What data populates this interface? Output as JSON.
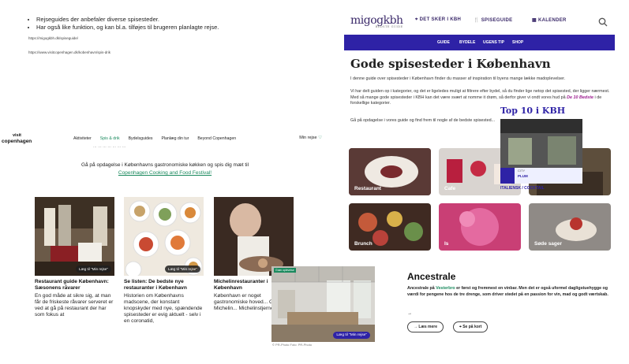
{
  "notes": {
    "bullets": [
      "Rejseguides der anbefaler diverse spisesteder.",
      "Har også like funktion, og kan bl.a. tilføjes til brugeren planlagte rejse."
    ],
    "urls": [
      "https://migogkbh.dk/spiseguide/",
      "https://www.visitcopenhagen.dk/kobenhavn/spis-drik"
    ]
  },
  "visitcph": {
    "logo_small": "visit",
    "logo_big": "copenhagen",
    "menu": [
      "Aktiviteter",
      "Spis & drik",
      "Bydelsguides",
      "Planlæg din tur",
      "Beyond Copenhagen"
    ],
    "my_trip": "Min rejse",
    "cut_text": "... ... ... ... ... ... ...",
    "intro": "Gå på opdagelse i Københavns gastronomiske køkken og spis dig mæt til",
    "intro_link": "Copenhagen Cooking and Food Festival!",
    "save_label": "Læg til \"Min rejse\"",
    "cards": [
      {
        "title": "Restaurant guide København: Sæsonens råvarer",
        "text": "En god måde at sikre sig, at man får de friskeste råvarer serveret er ved at gå på restaurant der har som fokus at"
      },
      {
        "title": "Se listen: De bedste nye restauranter i København",
        "text": "Historien om Københavns madscene, der konstant knopskyder med nye, spændende spisesteder er evig aktuelt - selv i en coronatid,"
      },
      {
        "title": "Michelinrestauranter i København",
        "text": "København er noget gastronomiske hoved... Guide Michelin... Michelinstjerner..."
      }
    ]
  },
  "migogkbh": {
    "logo": "migogkbh",
    "logo_sub": "BEDSTE GUIDE",
    "top_nav": [
      "DET SKER I KBH",
      "SPISEGUIDE",
      "KALENDER"
    ],
    "sub_nav": [
      "GUIDE",
      "BYDELE",
      "UGENS TIP",
      "SHOP"
    ],
    "title": "Gode spisesteder i København",
    "p1": "I denne guide over spisesteder i København finder du masser af inspiration til byens mange lække madoplevelser.",
    "p2": "Vi har delt guiden op i kategorier, og det er ligeledes muligt at filtrere efter bydel, så du finder lige netop det spisested, der ligger nærmest. Med så mange gode spisesteder i KBH kan det være svært at nomme it drøm, så derfor giver vi ondt vores hud på",
    "p2_link": "De 10 Bedste",
    "p2_end": " i de forskellige kategorier.",
    "p3": "Gå på opdagelse i vores guide og find frem til nogle af de bedste spisested...",
    "tiles": [
      "Restaurant",
      "Cafe",
      "",
      "Brunch",
      "Is",
      "Søde sager"
    ],
    "top10_title": "Top 10 i KBH",
    "top10_tag": "CITY",
    "top10_name": "PLUM",
    "top10_label": "ITALIENSK / COCKTAIL"
  },
  "ancestrale": {
    "badge": "Grøn oplevelse",
    "save_label": "Læg til \"Min rejse\"",
    "credit": "© PR-Photo   Foto: PR-Photo",
    "title": "Ancestrale",
    "text_a": "Ancestrale på ",
    "text_link": "Vesterbro",
    "text_b": " er først og fremmest en vinbar. Men det er også uformel dagligstuehygge og værdi for pengene hos de tre drenge, som driver stedet på en passion for vin, mad og godt værtskab.",
    "arrow": "→",
    "read_more": "Læs mere",
    "map": "Se på kort"
  }
}
